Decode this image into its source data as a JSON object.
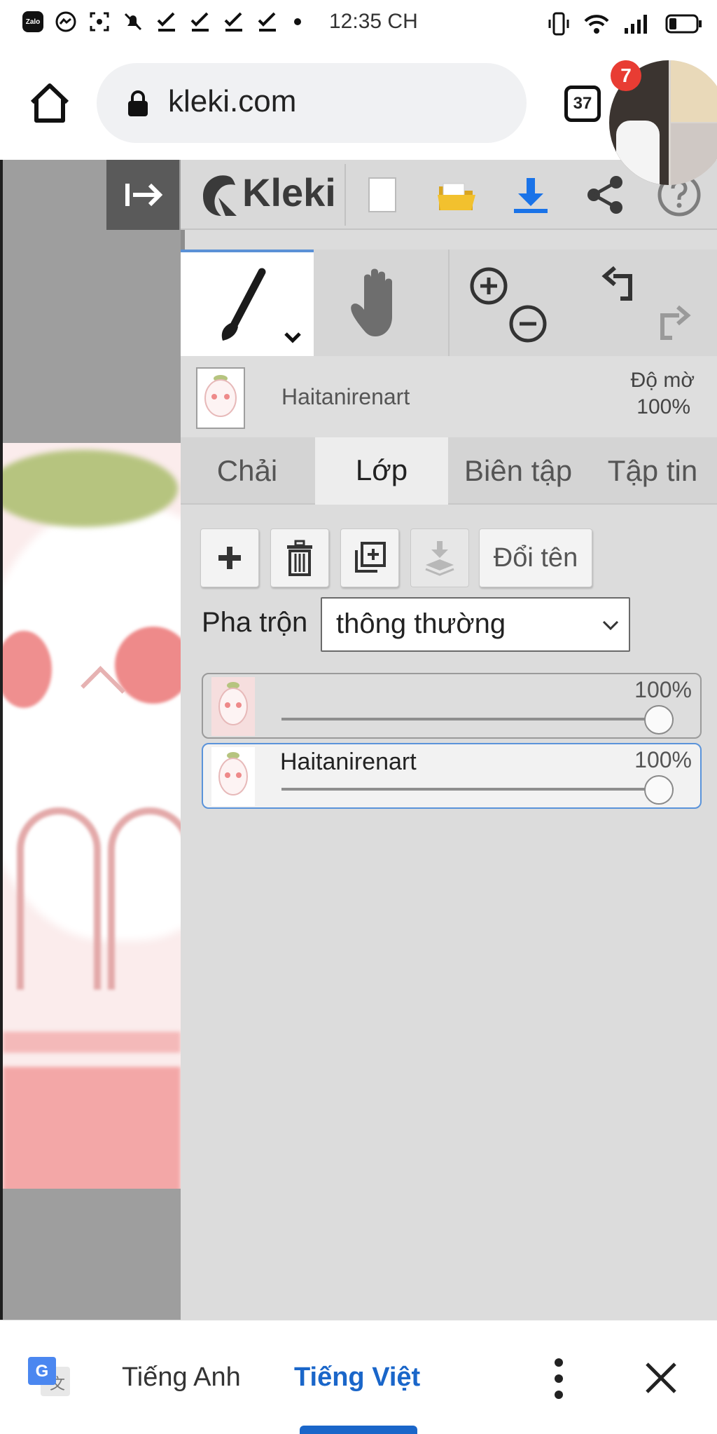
{
  "status_bar": {
    "time": "12:35 CH",
    "left_icons": [
      "zalo-icon",
      "messenger-icon",
      "screenshot-icon",
      "mute-icon",
      "check-icon",
      "check-icon",
      "check-icon",
      "check-icon",
      "dot-icon"
    ],
    "zalo_label": "Zalo",
    "right_icons": [
      "vibrate-icon",
      "wifi-icon",
      "signal-icon",
      "battery-icon"
    ]
  },
  "browser": {
    "url": "kleki.com",
    "tab_count": "37",
    "chat_bubble_badge": "7"
  },
  "app": {
    "logo_text": "Kleki",
    "toolbar_icons": [
      "new-image-icon",
      "open-folder-icon",
      "download-icon",
      "share-icon",
      "help-icon"
    ],
    "tools": [
      "brush-icon",
      "hand-icon",
      "zoom-in-icon",
      "zoom-out-icon",
      "undo-icon",
      "redo-icon"
    ],
    "layer_info": {
      "name": "Haitanirenart",
      "opacity_label": "Độ mờ",
      "opacity_value": "100%"
    },
    "tabs": [
      {
        "label": "Chải",
        "active": false
      },
      {
        "label": "Lớp",
        "active": true
      },
      {
        "label": "Biên tập",
        "active": false
      },
      {
        "label": "Tập tin",
        "active": false
      }
    ],
    "layer_buttons": {
      "add": "plus-icon",
      "delete": "trash-icon",
      "duplicate": "duplicate-icon",
      "merge_down": "merge-down-icon",
      "rename_label": "Đổi tên"
    },
    "blend": {
      "label": "Pha trộn",
      "value": "thông thường"
    },
    "layers": [
      {
        "name": "",
        "opacity": "100%",
        "opacity_value": 1.0,
        "selected": false
      },
      {
        "name": "Haitanirenart",
        "opacity": "100%",
        "opacity_value": 1.0,
        "selected": true
      }
    ]
  },
  "translate_bar": {
    "source_lang": "Tiếng Anh",
    "target_lang": "Tiếng Việt",
    "active_color": "#1a66c9"
  },
  "colors": {
    "accent_blue": "#5b91d6",
    "download_blue": "#1a73e8",
    "folder_yellow": "#f2c12e",
    "badge_red": "#e83c33"
  }
}
